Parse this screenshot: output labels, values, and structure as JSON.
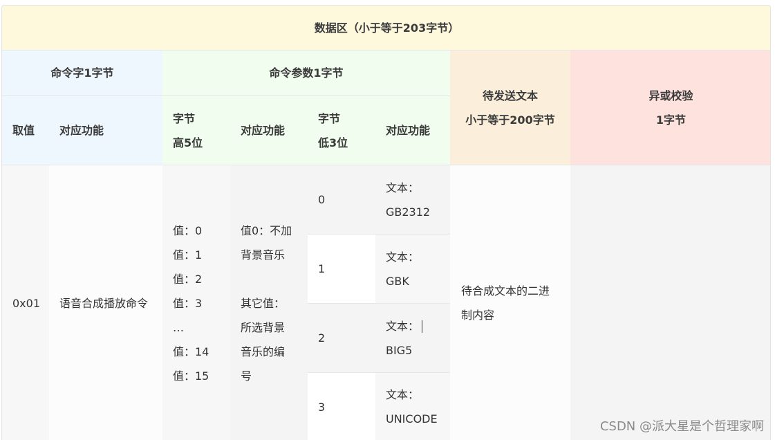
{
  "table": {
    "title": "数据区（小于等于203字节）",
    "group_cmd_word": "命令字1字节",
    "group_cmd_param": "命令参数1字节",
    "send_text_line1": "待发送文本",
    "send_text_line2": "小于等于200字节",
    "xor_line1": "异或校验",
    "xor_line2": "1字节",
    "col_value": "取值",
    "col_function": "对应功能",
    "col_high5_line1": "字节",
    "col_high5_line2": "高5位",
    "col_function2": "对应功能",
    "col_low3_line1": "字节",
    "col_low3_line2": "低3位",
    "col_function3": "对应功能",
    "row": {
      "value": "0x01",
      "function": "语音合成播放命令",
      "high5_values": [
        "值：0",
        "值：1",
        "值：2",
        "值：3",
        "…",
        "值：14",
        "值：15"
      ],
      "bgm_line1": "值0：不加",
      "bgm_line2": "背景音乐",
      "bgm_line3": "其它值：",
      "bgm_line4": "所选背景",
      "bgm_line5": "音乐的编",
      "bgm_line6": "号",
      "encodings": [
        {
          "low3": "0",
          "label": "文本：",
          "code": "GB2312"
        },
        {
          "low3": "1",
          "label": "文本：",
          "code": "GBK"
        },
        {
          "low3": "2",
          "label": "文本：",
          "code": "BIG5"
        },
        {
          "low3": "3",
          "label": "文本：",
          "code": "UNICODE"
        }
      ],
      "text_content": "待合成文本的二进制内容"
    }
  },
  "watermark": "CSDN @派大星是个哲理家啊",
  "colors": {
    "title_bg": "#fef8dc",
    "cmd_word_bg": "#eef6fe",
    "cmd_param_bg": "#f1fdee",
    "send_text_bg": "#fbeedb",
    "xor_bg": "#fde2de"
  }
}
